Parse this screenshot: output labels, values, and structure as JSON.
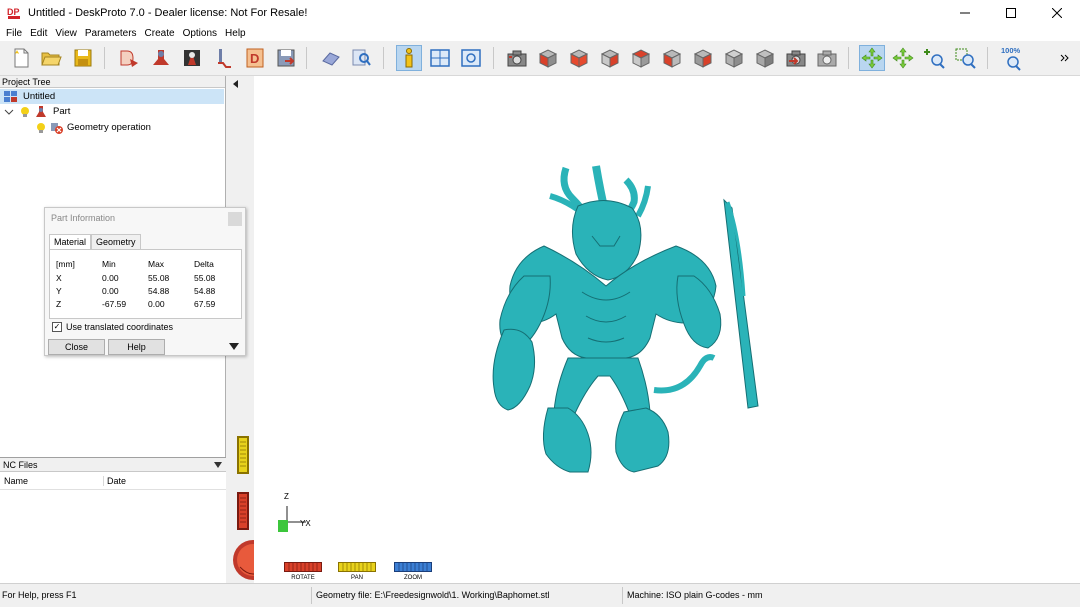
{
  "window": {
    "title": "Untitled - DeskProto 7.0 - Dealer license: Not For Resale!",
    "logo_text": "DP"
  },
  "menu": [
    "File",
    "Edit",
    "View",
    "Parameters",
    "Create",
    "Options",
    "Help"
  ],
  "toolbar": {
    "zoom_badge": "100%"
  },
  "project_tree": {
    "header": "Project Tree",
    "root": "Untitled",
    "part": "Part",
    "operation": "Geometry operation"
  },
  "nc_files": {
    "header": "NC Files",
    "col_name": "Name",
    "col_date": "Date"
  },
  "part_info": {
    "title": "Part Information",
    "tabs": [
      "Material",
      "Geometry"
    ],
    "headers": [
      "[mm]",
      "Min",
      "Max",
      "Delta"
    ],
    "rows": [
      [
        "X",
        "0.00",
        "55.08",
        "55.08"
      ],
      [
        "Y",
        "0.00",
        "54.88",
        "54.88"
      ],
      [
        "Z",
        "-67.59",
        "0.00",
        "67.59"
      ]
    ],
    "checkbox_label": "Use translated coordinates",
    "checkbox_checked": true,
    "close_label": "Close",
    "help_label": "Help"
  },
  "axis": {
    "z": "Z",
    "yx": "YX"
  },
  "controls": {
    "rotate": "ROTATE",
    "pan": "PAN",
    "zoom": "ZOOM"
  },
  "status": {
    "help": "For Help, press F1",
    "geometry": "Geometry file: E:\\Freedesignwold\\1. Working\\Baphomet.stl",
    "machine": "Machine: ISO plain G-codes - mm"
  },
  "colors": {
    "model": "#2ab3b8",
    "selection": "#cce4f7",
    "rotate": "#d9412a",
    "pan": "#e8d21c",
    "zoom": "#3c7fd4"
  }
}
